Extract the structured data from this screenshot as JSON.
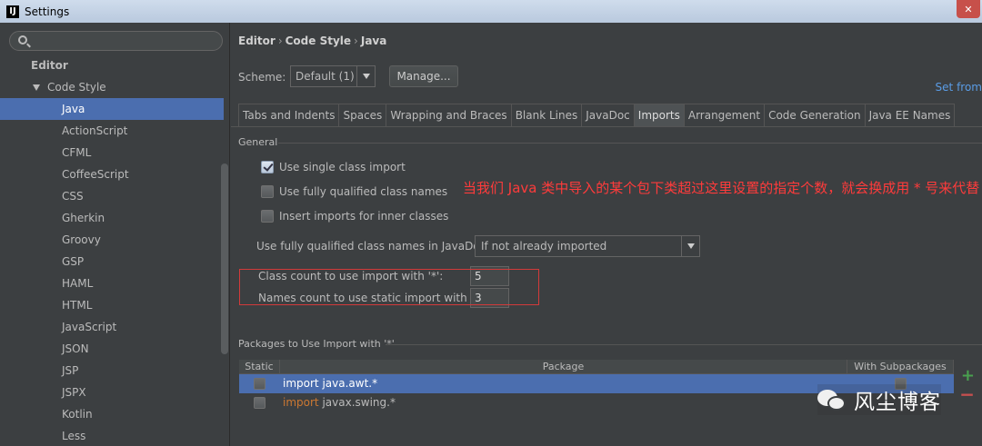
{
  "window": {
    "title": "Settings",
    "logo_text": "IJ"
  },
  "sidebar": {
    "search": {
      "placeholder": ""
    },
    "items": [
      {
        "label": "Editor"
      },
      {
        "label": "Code Style"
      },
      {
        "label": "Java"
      },
      {
        "label": "ActionScript"
      },
      {
        "label": "CFML"
      },
      {
        "label": "CoffeeScript"
      },
      {
        "label": "CSS"
      },
      {
        "label": "Gherkin"
      },
      {
        "label": "Groovy"
      },
      {
        "label": "GSP"
      },
      {
        "label": "HAML"
      },
      {
        "label": "HTML"
      },
      {
        "label": "JavaScript"
      },
      {
        "label": "JSON"
      },
      {
        "label": "JSP"
      },
      {
        "label": "JSPX"
      },
      {
        "label": "Kotlin"
      },
      {
        "label": "Less"
      }
    ],
    "selected_item": "Java"
  },
  "breadcrumb": [
    "Editor",
    "Code Style",
    "Java"
  ],
  "breadcrumb_separator": "›",
  "scheme": {
    "label": "Scheme:",
    "value": "Default (1)",
    "manage_label": "Manage...",
    "set_from_label": "Set from"
  },
  "tabs": [
    {
      "label": "Tabs and Indents"
    },
    {
      "label": "Spaces"
    },
    {
      "label": "Wrapping and Braces"
    },
    {
      "label": "Blank Lines"
    },
    {
      "label": "JavaDoc"
    },
    {
      "label": "Imports"
    },
    {
      "label": "Arrangement"
    },
    {
      "label": "Code Generation"
    },
    {
      "label": "Java EE Names"
    }
  ],
  "active_tab": "Imports",
  "general": {
    "title": "General",
    "checkboxes": [
      {
        "label": "Use single class import",
        "checked": true
      },
      {
        "label": "Use fully qualified class names",
        "checked": false
      },
      {
        "label": "Insert imports for inner classes",
        "checked": false
      }
    ],
    "javadoc_label": "Use fully qualified class names in JavaDoc:",
    "javadoc_value": "If not already imported",
    "class_count_label": "Class count to use import with '*':",
    "class_count_value": "5",
    "names_count_label": "Names count to use static import with '*':",
    "names_count_value": "3"
  },
  "annotation": {
    "text": "当我们 Java 类中导入的某个包下类超过这里设置的指定个数，就会换成用 * 号来代替",
    "color": "#ff3b3b"
  },
  "packages": {
    "title": "Packages to Use Import with '*'",
    "columns": [
      "Static",
      "Package",
      "With Subpackages"
    ],
    "rows": [
      {
        "keyword": "import",
        "name": "java.awt.*",
        "static": false,
        "with_subpackages": false,
        "selected": true
      },
      {
        "keyword": "import",
        "name": "javax.swing.*",
        "static": false,
        "with_subpackages": false,
        "selected": false
      }
    ],
    "add_icon": "plus-icon",
    "remove_icon": "minus-icon"
  },
  "watermark": {
    "text": "风尘博客",
    "icon": "wechat-icon"
  },
  "colors": {
    "selection": "#4b6eaf",
    "link": "#5a9ce5",
    "add": "#49a04f",
    "remove": "#c74f4f",
    "keyword": "#cc7832"
  }
}
